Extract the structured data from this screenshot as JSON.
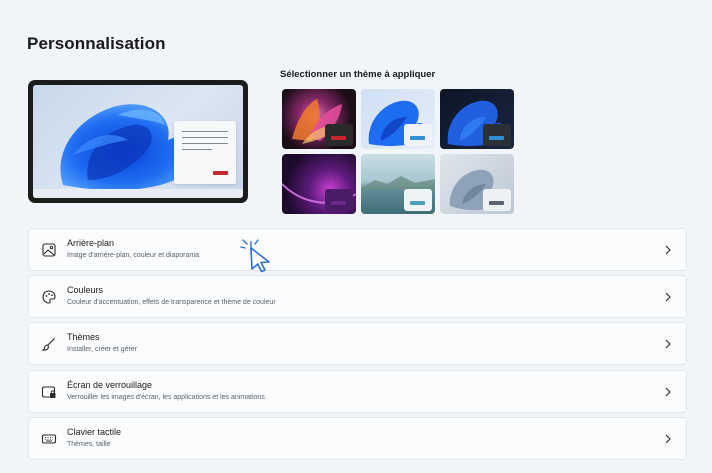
{
  "page": {
    "title": "Personnalisation"
  },
  "preview": {
    "accent_color": "#c4262e"
  },
  "themes": {
    "label": "Sélectionner un thème à appliquer",
    "tiles": [
      {
        "name": "theme-glow",
        "accent": "#c4262e"
      },
      {
        "name": "theme-light-bloom",
        "accent": "#2f8ed6"
      },
      {
        "name": "theme-dark-bloom",
        "accent": "#2f8ed6"
      },
      {
        "name": "theme-captured-motion",
        "accent": "#6b2a8a"
      },
      {
        "name": "theme-flow",
        "accent": "#4aa1b6"
      },
      {
        "name": "theme-sunrise",
        "accent": "#5a6470"
      }
    ]
  },
  "settings": [
    {
      "label": "Arrière-plan",
      "description": "Image d'arrière-plan, couleur et diaporama",
      "icon": "image-icon"
    },
    {
      "label": "Couleurs",
      "description": "Couleur d'accentuation, effets de transparence et thème de couleur",
      "icon": "palette-icon"
    },
    {
      "label": "Thèmes",
      "description": "Installer, créer et gérer",
      "icon": "brush-icon"
    },
    {
      "label": "Écran de verrouillage",
      "description": "Verrouiller les images d'écran, les applications et les animations",
      "icon": "lock-screen-icon"
    },
    {
      "label": "Clavier tactile",
      "description": "Thèmes, taille",
      "icon": "keyboard-icon"
    }
  ]
}
